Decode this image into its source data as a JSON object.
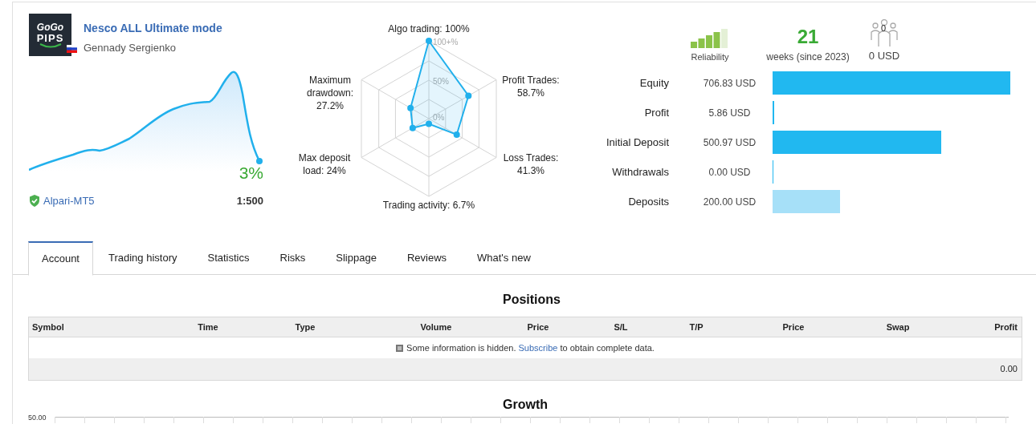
{
  "signal": {
    "logo_text": [
      "GoGo",
      "PIPS"
    ],
    "title": "Nesco ALL Ultimate mode",
    "author": "Gennady Sergienko",
    "growth": "3%",
    "broker": "Alpari-MT5",
    "leverage": "1:500"
  },
  "radar": {
    "ticks": [
      "100+%",
      "50%",
      "0%"
    ],
    "axes": [
      {
        "label": [
          "Algo trading: 100%"
        ]
      },
      {
        "label": [
          "Maximum",
          "drawdown:",
          "27.2%"
        ]
      },
      {
        "label": [
          "Profit Trades:",
          "58.7%"
        ]
      },
      {
        "label": [
          "Max deposit",
          "load: 24%"
        ]
      },
      {
        "label": [
          "Loss Trades:",
          "41.3%"
        ]
      },
      {
        "label": [
          "Trading activity: 6.7%"
        ]
      }
    ]
  },
  "summary": {
    "reliability": {
      "label": "Reliability",
      "level": 0.8
    },
    "weeks": {
      "value": "21",
      "label": "weeks (since 2023)"
    },
    "subscribers": {
      "count": "0",
      "amount": "0 USD"
    }
  },
  "balances": [
    {
      "label": "Equity",
      "value": "706.83 USD",
      "color": "#21b8f0"
    },
    {
      "label": "Profit",
      "value": "5.86 USD",
      "color": "#21b8f0"
    },
    {
      "label": "Initial Deposit",
      "value": "500.97 USD",
      "color": "#21b8f0"
    },
    {
      "label": "Withdrawals",
      "value": "0.00 USD",
      "color": "#21b8f0"
    },
    {
      "label": "Deposits",
      "value": "200.00 USD",
      "color": "#a6e0f8"
    }
  ],
  "tabs": [
    {
      "label": "Account",
      "selected": true
    },
    {
      "label": "Trading history",
      "selected": false
    },
    {
      "label": "Statistics",
      "selected": false
    },
    {
      "label": "Risks",
      "selected": false
    },
    {
      "label": "Slippage",
      "selected": false
    },
    {
      "label": "Reviews",
      "selected": false
    },
    {
      "label": "What's new",
      "selected": false
    }
  ],
  "positions": {
    "title": "Positions",
    "columns": [
      "Symbol",
      "Time",
      "Type",
      "Volume",
      "Price",
      "S/L",
      "T/P",
      "Price",
      "Swap",
      "Profit"
    ],
    "notice": {
      "before": "Some information is hidden.",
      "link": "Subscribe",
      "after": "to obtain complete data."
    },
    "total": "0.00"
  },
  "growth": {
    "title": "Growth",
    "y_tick": "50.00"
  }
}
